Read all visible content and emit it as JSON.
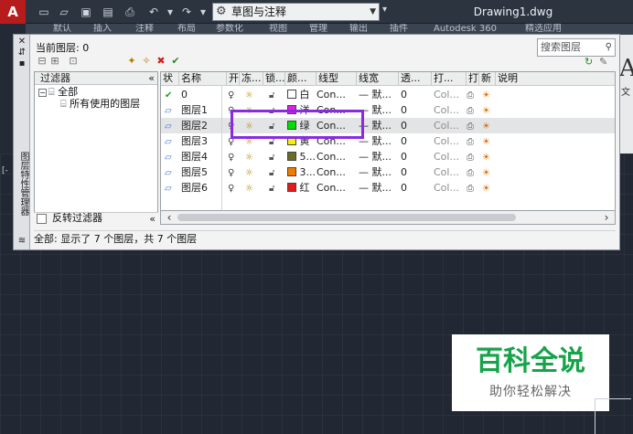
{
  "titlebar": {
    "app_letter": "A",
    "workspace": "草图与注释",
    "document_title": "Drawing1.dwg"
  },
  "ribbon": {
    "tabs": [
      "默认",
      "插入",
      "注释",
      "布局",
      "参数化",
      "视图",
      "管理",
      "输出",
      "插件",
      "Autodesk 360",
      "精选应用"
    ],
    "panel_big_letter": "A",
    "panel_small_text": "文"
  },
  "canvas": {
    "left_label": "[-"
  },
  "palette": {
    "side_title": "图层特性管理器",
    "current_layer": "当前图层: 0",
    "search_placeholder": "搜索图层",
    "filter_header": "过滤器",
    "tree": {
      "root": "全部",
      "child": "所有使用的图层"
    },
    "invert_label": "反转过滤器",
    "status": "全部: 显示了 7 个图层，共 7 个图层",
    "columns": [
      "状",
      "名称",
      "开",
      "冻...",
      "锁...",
      "颜...",
      "线型",
      "线宽",
      "透...",
      "打...",
      "打",
      "新",
      "说明"
    ],
    "rows": [
      {
        "name": "0",
        "color_name": "白",
        "color_hex": "#ffffff",
        "linetype": "Con...",
        "lineweight": "— 默...",
        "transparency": "0",
        "plotstyle": "Col...",
        "current": true
      },
      {
        "name": "图层1",
        "color_name": "洋",
        "color_hex": "#e020e0",
        "linetype": "Con...",
        "lineweight": "— 默...",
        "transparency": "0",
        "plotstyle": "Col...",
        "current": false
      },
      {
        "name": "图层2",
        "color_name": "绿",
        "color_hex": "#00e000",
        "linetype": "Con...",
        "lineweight": "— 默...",
        "transparency": "0",
        "plotstyle": "Col...",
        "current": false
      },
      {
        "name": "图层3",
        "color_name": "黄",
        "color_hex": "#f2f200",
        "linetype": "Con...",
        "lineweight": "— 默...",
        "transparency": "0",
        "plotstyle": "Col...",
        "current": false
      },
      {
        "name": "图层4",
        "color_name": "5...",
        "color_hex": "#6b6b2a",
        "linetype": "Con...",
        "lineweight": "— 默...",
        "transparency": "0",
        "plotstyle": "Col...",
        "current": false
      },
      {
        "name": "图层5",
        "color_name": "3...",
        "color_hex": "#f07d00",
        "linetype": "Con...",
        "lineweight": "— 默...",
        "transparency": "0",
        "plotstyle": "Col...",
        "current": false
      },
      {
        "name": "图层6",
        "color_name": "红",
        "color_hex": "#e21b1b",
        "linetype": "Con...",
        "lineweight": "— 默...",
        "transparency": "0",
        "plotstyle": "Col...",
        "current": false
      }
    ]
  },
  "watermark": {
    "title": "百科全说",
    "subtitle": "助你轻松解决"
  }
}
